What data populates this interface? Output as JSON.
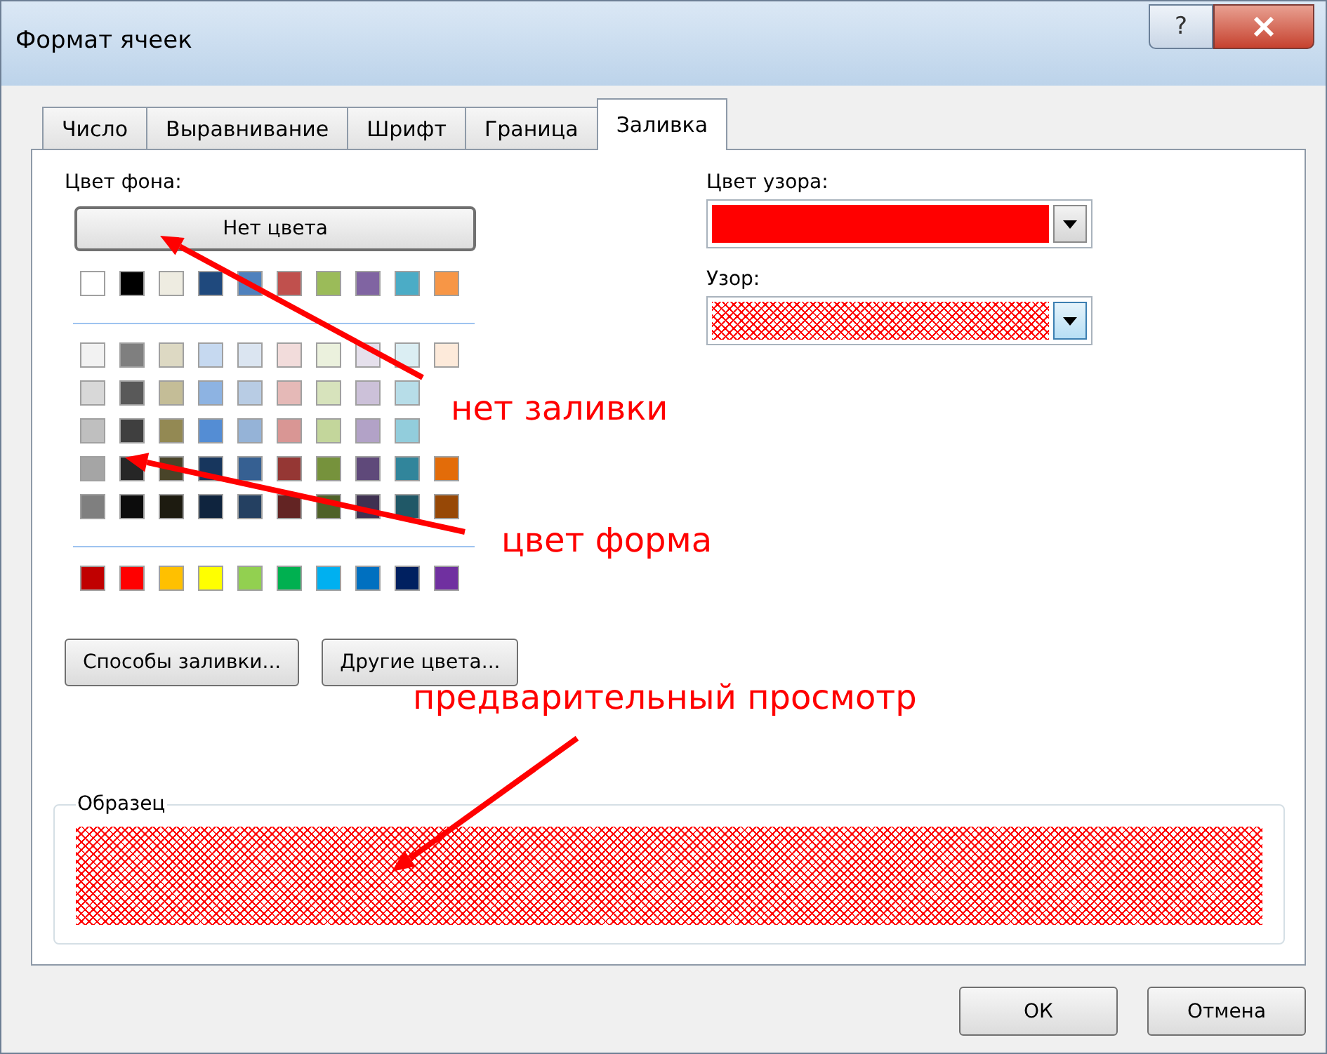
{
  "window": {
    "title": "Формат ячеек",
    "help_button": "?"
  },
  "tabs": [
    {
      "label": "Число",
      "selected": false
    },
    {
      "label": "Выравнивание",
      "selected": false
    },
    {
      "label": "Шрифт",
      "selected": false
    },
    {
      "label": "Граница",
      "selected": false
    },
    {
      "label": "Заливка",
      "selected": true
    }
  ],
  "background_color": {
    "label": "Цвет фона:",
    "no_color_button": "Нет цвета",
    "palette_groups": [
      {
        "rows": [
          [
            {
              "color": "#ffffff"
            },
            {
              "color": "#000000"
            },
            {
              "color": "#eeece1"
            },
            {
              "color": "#1f497d"
            },
            {
              "color": "#4f81bd"
            },
            {
              "color": "#c0504d"
            },
            {
              "color": "#9bbb59"
            },
            {
              "color": "#8064a2"
            },
            {
              "color": "#4bacc6"
            },
            {
              "color": "#f79646"
            }
          ]
        ]
      },
      {
        "rows": [
          [
            {
              "color": "#f2f2f2"
            },
            {
              "color": "#7f7f7f"
            },
            {
              "color": "#ddd9c3"
            },
            {
              "color": "#c6d9f0"
            },
            {
              "color": "#dbe5f1"
            },
            {
              "color": "#f2dcdb"
            },
            {
              "color": "#ebf1dd"
            },
            {
              "color": "#e5e0ec"
            },
            {
              "color": "#dbeef3"
            },
            {
              "color": "#fdeada"
            }
          ],
          [
            {
              "color": "#d8d8d8"
            },
            {
              "color": "#595959"
            },
            {
              "color": "#c4bd97"
            },
            {
              "color": "#8db3e2"
            },
            {
              "color": "#b8cce4"
            },
            {
              "color": "#e5b9b7"
            },
            {
              "color": "#d7e3bc"
            },
            {
              "color": "#ccc1d9"
            },
            {
              "color": "#b7dde8"
            }
          ],
          [
            {
              "color": "#bfbfbf"
            },
            {
              "color": "#3f3f3f"
            },
            {
              "color": "#938953"
            },
            {
              "color": "#548dd4"
            },
            {
              "color": "#95b3d7"
            },
            {
              "color": "#d99694"
            },
            {
              "color": "#c3d69b"
            },
            {
              "color": "#b2a2c7"
            },
            {
              "color": "#92cddc"
            }
          ],
          [
            {
              "color": "#a5a5a5"
            },
            {
              "color": "#262626"
            },
            {
              "color": "#494429"
            },
            {
              "color": "#17365d"
            },
            {
              "color": "#366092"
            },
            {
              "color": "#953734"
            },
            {
              "color": "#76923c"
            },
            {
              "color": "#5f497a"
            },
            {
              "color": "#31859b"
            },
            {
              "color": "#e36c09"
            }
          ],
          [
            {
              "color": "#7f7f7f"
            },
            {
              "color": "#0c0c0c"
            },
            {
              "color": "#1d1b10"
            },
            {
              "color": "#0f243e"
            },
            {
              "color": "#244061"
            },
            {
              "color": "#632423"
            },
            {
              "color": "#4f6128"
            },
            {
              "color": "#3f3151"
            },
            {
              "color": "#205867"
            },
            {
              "color": "#974806"
            }
          ]
        ]
      },
      {
        "rows": [
          [
            {
              "color": "#c00000"
            },
            {
              "color": "#ff0000"
            },
            {
              "color": "#ffc000"
            },
            {
              "color": "#ffff00"
            },
            {
              "color": "#92d050"
            },
            {
              "color": "#00b050"
            },
            {
              "color": "#00b0f0"
            },
            {
              "color": "#0070c0"
            },
            {
              "color": "#002060"
            },
            {
              "color": "#7030a0"
            }
          ]
        ]
      }
    ],
    "buttons": [
      "Способы заливки...",
      "Другие цвета..."
    ]
  },
  "pattern_color": {
    "label": "Цвет узора:",
    "color": "#ff0000"
  },
  "pattern": {
    "label": "Узор:",
    "kind": "crosshatch"
  },
  "sample": {
    "label": "Образец"
  },
  "annotations": [
    {
      "text": "нет заливки"
    },
    {
      "text": "цвет форма"
    },
    {
      "text": "предварительный просмотр"
    }
  ],
  "buttons": [
    {
      "label": "ОК"
    },
    {
      "label": "Отмена"
    }
  ]
}
